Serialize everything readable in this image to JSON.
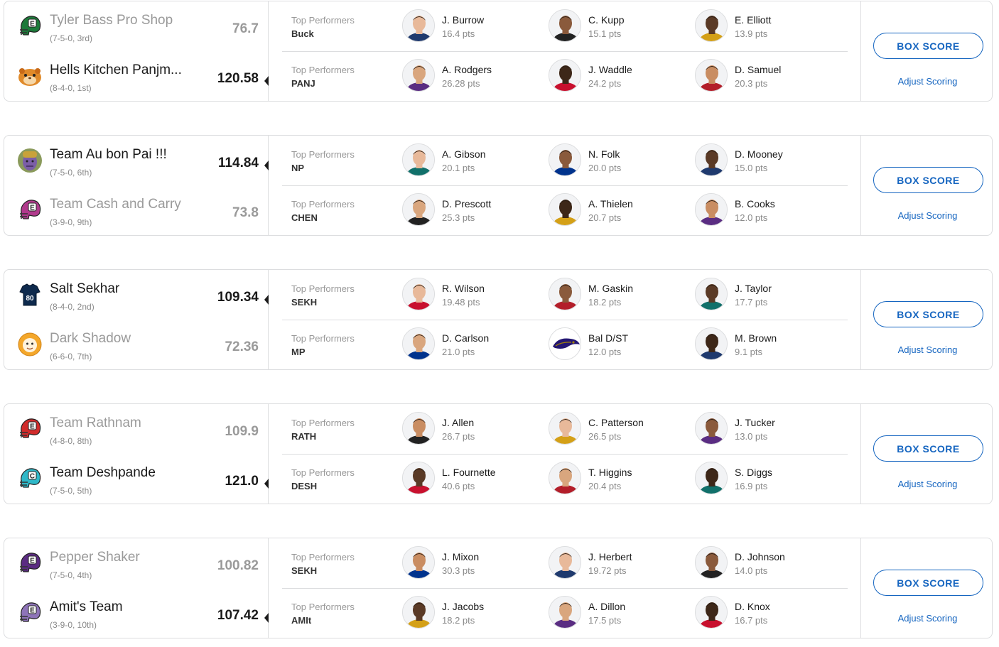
{
  "ui": {
    "top_performers_label": "Top Performers",
    "box_score_label": "BOX SCORE",
    "adjust_scoring_label": "Adjust Scoring",
    "accent_color": "#1565c0"
  },
  "matchups": [
    {
      "teams": [
        {
          "name": "Tyler Bass Pro Shop",
          "record": "(7-5-0, 3rd)",
          "score": "76.7",
          "winner": false,
          "logo": "helmet-green-e-icon",
          "abbrev": "Buck",
          "performers": [
            {
              "name": "J. Burrow",
              "pts": "16.4 pts"
            },
            {
              "name": "C. Kupp",
              "pts": "15.1 pts"
            },
            {
              "name": "E. Elliott",
              "pts": "13.9 pts"
            }
          ]
        },
        {
          "name": "Hells Kitchen Panjm...",
          "record": "(8-4-0, 1st)",
          "score": "120.58",
          "winner": true,
          "logo": "hamster-avatar-icon",
          "abbrev": "PANJ",
          "performers": [
            {
              "name": "A. Rodgers",
              "pts": "26.28 pts"
            },
            {
              "name": "J. Waddle",
              "pts": "24.2 pts"
            },
            {
              "name": "D. Samuel",
              "pts": "20.3 pts"
            }
          ]
        }
      ]
    },
    {
      "teams": [
        {
          "name": "Team Au bon Pai !!!",
          "record": "(7-5-0, 6th)",
          "score": "114.84",
          "winner": true,
          "logo": "thanos-avatar-icon",
          "abbrev": "NP",
          "performers": [
            {
              "name": "A. Gibson",
              "pts": "20.1 pts"
            },
            {
              "name": "N. Folk",
              "pts": "20.0 pts"
            },
            {
              "name": "D. Mooney",
              "pts": "15.0 pts"
            }
          ]
        },
        {
          "name": "Team Cash and Carry",
          "record": "(3-9-0, 9th)",
          "score": "73.8",
          "winner": false,
          "logo": "helmet-magenta-e-icon",
          "abbrev": "CHEN",
          "performers": [
            {
              "name": "D. Prescott",
              "pts": "25.3 pts"
            },
            {
              "name": "A. Thielen",
              "pts": "20.7 pts"
            },
            {
              "name": "B. Cooks",
              "pts": "12.0 pts"
            }
          ]
        }
      ]
    },
    {
      "teams": [
        {
          "name": "Salt Sekhar",
          "record": "(8-4-0, 2nd)",
          "score": "109.34",
          "winner": true,
          "logo": "jersey-80-icon",
          "abbrev": "SEKH",
          "performers": [
            {
              "name": "R. Wilson",
              "pts": "19.48 pts"
            },
            {
              "name": "M. Gaskin",
              "pts": "18.2 pts"
            },
            {
              "name": "J. Taylor",
              "pts": "17.7 pts"
            }
          ]
        },
        {
          "name": "Dark Shadow",
          "record": "(6-6-0, 7th)",
          "score": "72.36",
          "winner": false,
          "logo": "cartoon-avatar-icon",
          "abbrev": "MP",
          "performers": [
            {
              "name": "D. Carlson",
              "pts": "21.0 pts"
            },
            {
              "name": "Bal D/ST",
              "pts": "12.0 pts"
            },
            {
              "name": "M. Brown",
              "pts": "9.1 pts"
            }
          ]
        }
      ]
    },
    {
      "teams": [
        {
          "name": "Team Rathnam",
          "record": "(4-8-0, 8th)",
          "score": "109.9",
          "winner": false,
          "logo": "helmet-red-e-icon",
          "abbrev": "RATH",
          "performers": [
            {
              "name": "J. Allen",
              "pts": "26.7 pts"
            },
            {
              "name": "C. Patterson",
              "pts": "26.5 pts"
            },
            {
              "name": "J. Tucker",
              "pts": "13.0 pts"
            }
          ]
        },
        {
          "name": "Team Deshpande",
          "record": "(7-5-0, 5th)",
          "score": "121.0",
          "winner": true,
          "logo": "helmet-teal-c-icon",
          "abbrev": "DESH",
          "performers": [
            {
              "name": "L. Fournette",
              "pts": "40.6 pts"
            },
            {
              "name": "T. Higgins",
              "pts": "20.4 pts"
            },
            {
              "name": "S. Diggs",
              "pts": "16.9 pts"
            }
          ]
        }
      ]
    },
    {
      "teams": [
        {
          "name": "Pepper Shaker",
          "record": "(7-5-0, 4th)",
          "score": "100.82",
          "winner": false,
          "logo": "helmet-purple-e-icon",
          "abbrev": "SEKH",
          "performers": [
            {
              "name": "J. Mixon",
              "pts": "30.3 pts"
            },
            {
              "name": "J. Herbert",
              "pts": "19.72 pts"
            },
            {
              "name": "D. Johnson",
              "pts": "14.0 pts"
            }
          ]
        },
        {
          "name": "Amit's Team",
          "record": "(3-9-0, 10th)",
          "score": "107.42",
          "winner": true,
          "logo": "helmet-lavender-e-icon",
          "abbrev": "AMIt",
          "performers": [
            {
              "name": "J. Jacobs",
              "pts": "18.2 pts"
            },
            {
              "name": "A. Dillon",
              "pts": "17.5 pts"
            },
            {
              "name": "D. Knox",
              "pts": "16.7 pts"
            }
          ]
        }
      ]
    }
  ]
}
